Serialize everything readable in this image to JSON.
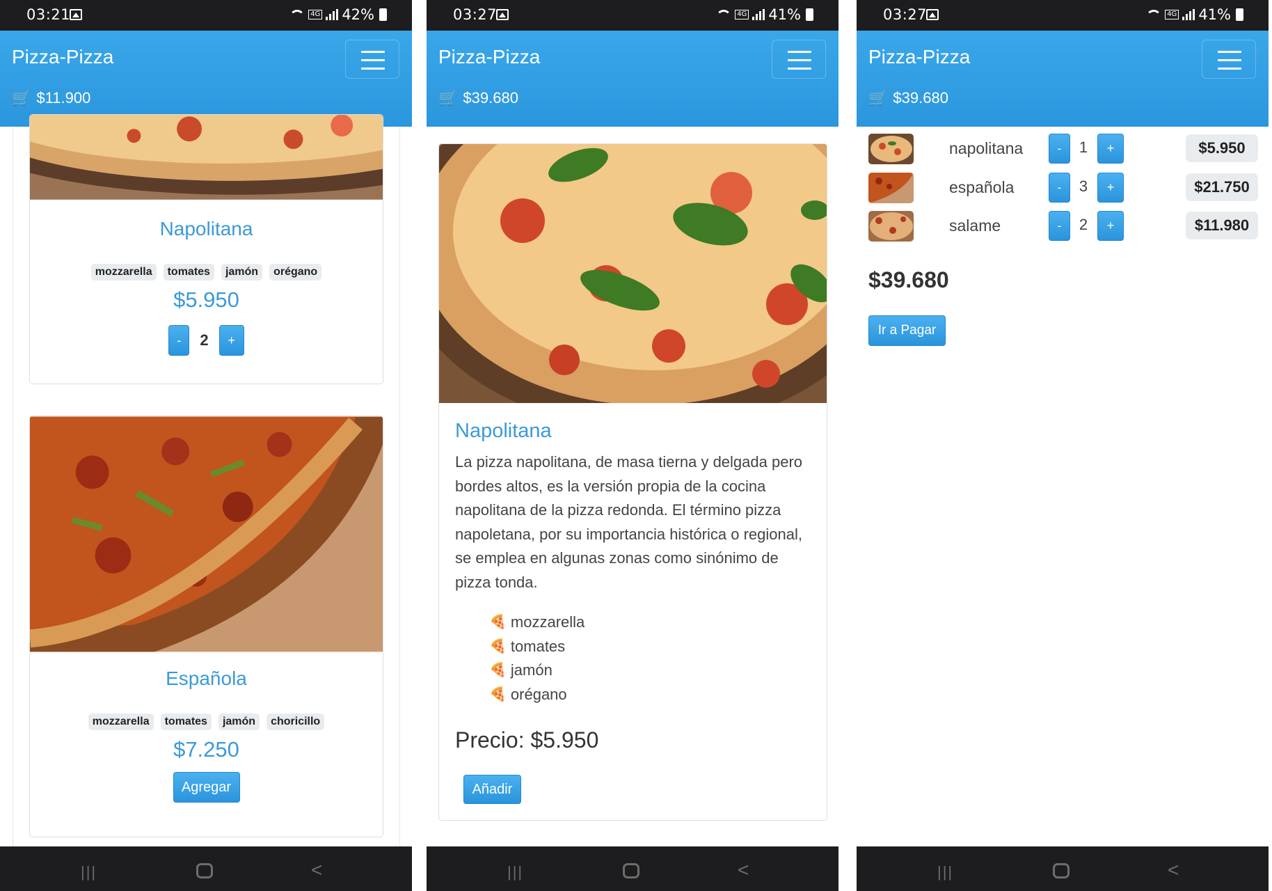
{
  "screens": [
    {
      "status": {
        "time": "03:21",
        "battery": "42%"
      },
      "navbar": {
        "brand": "Pizza-Pizza",
        "cart_total": "$11.900"
      },
      "cards": [
        {
          "title": "Napolitana",
          "ingredients": [
            "mozzarella",
            "tomates",
            "jamón",
            "orégano"
          ],
          "price": "$5.950",
          "quantity": "2",
          "minus": "-",
          "plus": "+"
        },
        {
          "title": "Española",
          "ingredients": [
            "mozzarella",
            "tomates",
            "jamón",
            "choricillo"
          ],
          "price": "$7.250",
          "button": "Agregar"
        }
      ]
    },
    {
      "status": {
        "time": "03:27",
        "battery": "41%"
      },
      "navbar": {
        "brand": "Pizza-Pizza",
        "cart_total": "$39.680"
      },
      "detail": {
        "title": "Napolitana",
        "description": "La pizza napolitana, de masa tierna y delgada pero bordes altos, es la versión propia de la cocina napolitana de la pizza redonda. El término pizza napoletana, por su importancia histórica o regional, se emplea en algunas zonas como sinónimo de pizza tonda.",
        "ingredients": [
          "mozzarella",
          "tomates",
          "jamón",
          "orégano"
        ],
        "price": "Precio: $5.950",
        "button": "Añadir"
      }
    },
    {
      "status": {
        "time": "03:27",
        "battery": "41%"
      },
      "navbar": {
        "brand": "Pizza-Pizza",
        "cart_total": "$39.680"
      },
      "cart": {
        "items": [
          {
            "name": "napolitana",
            "quantity": "1",
            "price": "$5.950",
            "minus": "-",
            "plus": "+"
          },
          {
            "name": "española",
            "quantity": "3",
            "price": "$21.750",
            "minus": "-",
            "plus": "+"
          },
          {
            "name": "salame",
            "quantity": "2",
            "price": "$11.980",
            "minus": "-",
            "plus": "+"
          }
        ],
        "total": "$39.680",
        "button": "Ir a Pagar"
      }
    }
  ],
  "icons": {
    "cart": "shopping-cart-icon",
    "ingredient_bullet": "pizza-slice-icon",
    "menu": "hamburger-menu-icon"
  },
  "colors": {
    "primary": "#2b96dd",
    "accent_text": "#3a9ad8",
    "status_bar": "#1d1d1f"
  }
}
